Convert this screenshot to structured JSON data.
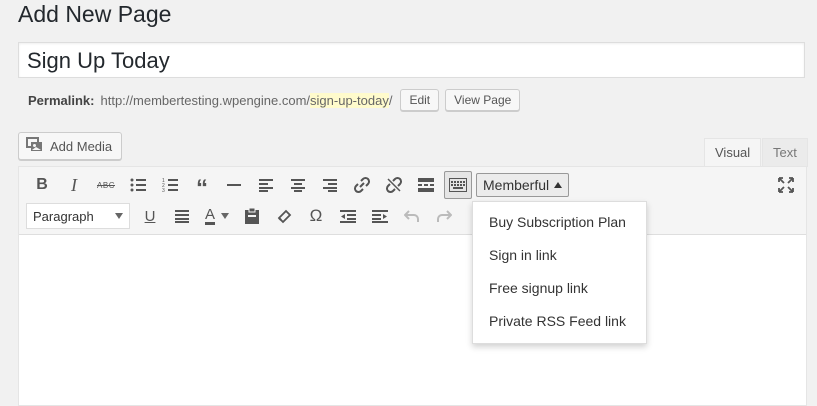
{
  "page": {
    "heading": "Add New Page"
  },
  "title_field": {
    "value": "Sign Up Today"
  },
  "permalink": {
    "label": "Permalink:",
    "base_url": "http://membertesting.wpengine.com/",
    "slug": "sign-up-today",
    "trailing": "/",
    "edit_label": "Edit",
    "view_label": "View Page"
  },
  "media": {
    "add_media_label": "Add Media"
  },
  "editor_tabs": {
    "visual": "Visual",
    "text": "Text"
  },
  "toolbar": {
    "memberful_label": "Memberful",
    "format_select_value": "Paragraph"
  },
  "memberful_menu": {
    "items": [
      {
        "label": "Buy Subscription Plan"
      },
      {
        "label": "Sign in link"
      },
      {
        "label": "Free signup link"
      },
      {
        "label": "Private RSS Feed link"
      }
    ]
  },
  "colors": {
    "slug_highlight": "#fffbcc",
    "text_primary": "#23282d"
  }
}
